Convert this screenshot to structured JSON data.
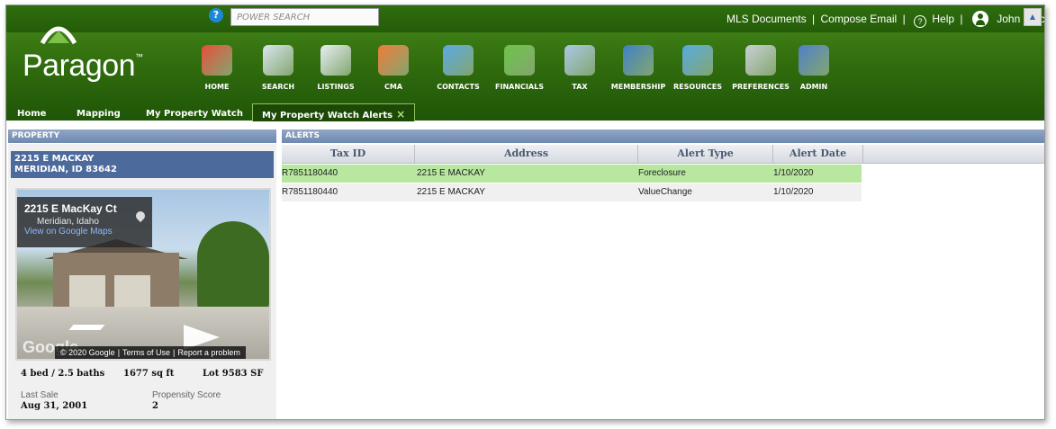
{
  "topbar": {
    "search_placeholder": "POWER SEARCH",
    "links": [
      "MLS Documents",
      "Compose Email"
    ],
    "help_label": "Help",
    "user_name": "John Stock",
    "separator": "|"
  },
  "logo": {
    "text": "Paragon",
    "mark": "™"
  },
  "nav": [
    {
      "label": "HOME",
      "icon": "house-icon",
      "color": "#e84d3a"
    },
    {
      "label": "SEARCH",
      "icon": "search-doc-icon",
      "color": "#d9e4ef"
    },
    {
      "label": "LISTINGS",
      "icon": "listings-icon",
      "color": "#e6edf4"
    },
    {
      "label": "CMA",
      "icon": "cma-chart-icon",
      "color": "#f07a3a"
    },
    {
      "label": "CONTACTS",
      "icon": "contacts-icon",
      "color": "#5aa7e6"
    },
    {
      "label": "FINANCIALS",
      "icon": "pie-chart-icon",
      "color": "#6cc24a"
    },
    {
      "label": "TAX",
      "icon": "tax-icon",
      "color": "#a9c7e6"
    },
    {
      "label": "MEMBERSHIP",
      "icon": "membership-icon",
      "color": "#3f7fc7"
    },
    {
      "label": "RESOURCES",
      "icon": "resources-icon",
      "color": "#56a9e2"
    },
    {
      "label": "PREFERENCES",
      "icon": "tools-icon",
      "color": "#c8cfd6"
    },
    {
      "label": "ADMIN",
      "icon": "admin-globe-icon",
      "color": "#4f7ec9"
    }
  ],
  "tabs": [
    {
      "label": "Home"
    },
    {
      "label": "Mapping"
    },
    {
      "label": "My Property Watch"
    },
    {
      "label": "My Property Watch Alerts",
      "active": true,
      "close": "×"
    }
  ],
  "property": {
    "section_label": "PROPERTY",
    "address_line1": "2215 E MACKAY",
    "address_line2": "MERIDIAN, ID 83642",
    "streetview": {
      "title": "2215 E MacKay Ct",
      "subtitle": "Meridian, Idaho",
      "link": "View on Google Maps",
      "watermark": "Google",
      "footer": [
        "© 2020 Google",
        "Terms of Use",
        "Report a problem"
      ]
    },
    "beds_baths": "4 bed / 2.5 baths",
    "sqft": "1677 sq ft",
    "lot": "Lot 9583 SF",
    "last_sale_label": "Last Sale",
    "last_sale_value": "Aug 31, 2001",
    "propensity_label": "Propensity Score",
    "propensity_value": "2"
  },
  "alerts": {
    "section_label": "ALERTS",
    "columns": [
      "Tax ID",
      "Address",
      "Alert Type",
      "Alert Date"
    ],
    "rows": [
      {
        "tax_id": "R7851180440",
        "address": "2215 E MACKAY",
        "alert_type": "Foreclosure",
        "alert_date": "1/10/2020"
      },
      {
        "tax_id": "R7851180440",
        "address": "2215 E MACKAY",
        "alert_type": "ValueChange",
        "alert_date": "1/10/2020"
      }
    ]
  },
  "colors": {
    "header_green": "#33700f",
    "section_blue": "#6f88ad",
    "selected_row": "#b8e7a0",
    "address_bar": "#4c6a9c"
  }
}
